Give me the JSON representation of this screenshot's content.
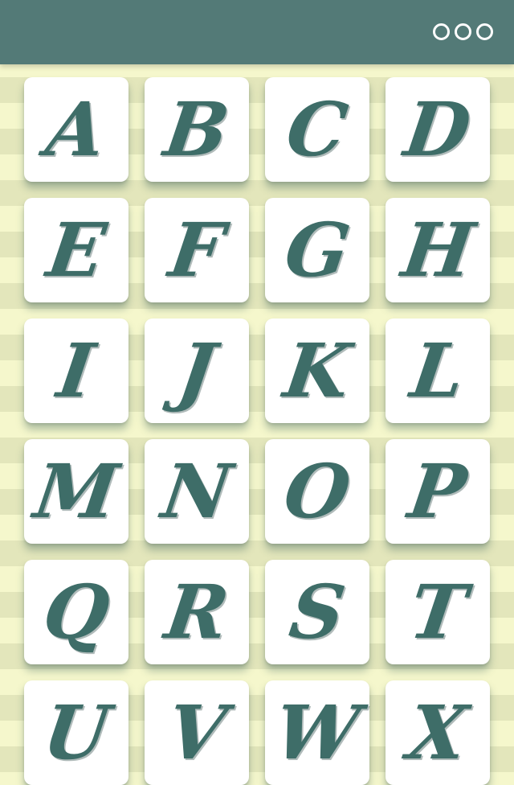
{
  "header": {
    "menu_icon": "more-circles-icon",
    "background_color": "#537a77"
  },
  "colors": {
    "letter": "#3e6d68",
    "tile": "#ffffff",
    "stripe_light": "#f5f7cc",
    "stripe_dark": "#e3e6bb"
  },
  "letters": [
    "A",
    "B",
    "C",
    "D",
    "E",
    "F",
    "G",
    "H",
    "I",
    "J",
    "K",
    "L",
    "M",
    "N",
    "O",
    "P",
    "Q",
    "R",
    "S",
    "T",
    "U",
    "V",
    "W",
    "X"
  ]
}
